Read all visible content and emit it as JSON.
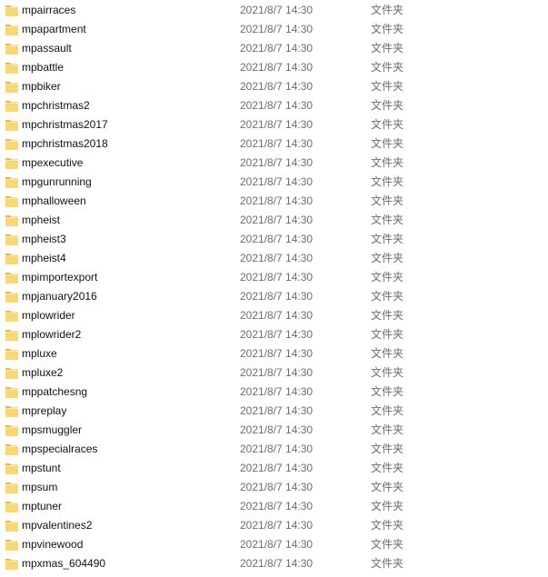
{
  "icons": {
    "folder": "folder-icon",
    "folder_color": "#F8D775",
    "folder_tab_color": "#E8B84A"
  },
  "files": [
    {
      "name": "mpairraces",
      "modified": "2021/8/7 14:30",
      "type": "文件夹"
    },
    {
      "name": "mpapartment",
      "modified": "2021/8/7 14:30",
      "type": "文件夹"
    },
    {
      "name": "mpassault",
      "modified": "2021/8/7 14:30",
      "type": "文件夹"
    },
    {
      "name": "mpbattle",
      "modified": "2021/8/7 14:30",
      "type": "文件夹"
    },
    {
      "name": "mpbiker",
      "modified": "2021/8/7 14:30",
      "type": "文件夹"
    },
    {
      "name": "mpchristmas2",
      "modified": "2021/8/7 14:30",
      "type": "文件夹"
    },
    {
      "name": "mpchristmas2017",
      "modified": "2021/8/7 14:30",
      "type": "文件夹"
    },
    {
      "name": "mpchristmas2018",
      "modified": "2021/8/7 14:30",
      "type": "文件夹"
    },
    {
      "name": "mpexecutive",
      "modified": "2021/8/7 14:30",
      "type": "文件夹"
    },
    {
      "name": "mpgunrunning",
      "modified": "2021/8/7 14:30",
      "type": "文件夹"
    },
    {
      "name": "mphalloween",
      "modified": "2021/8/7 14:30",
      "type": "文件夹"
    },
    {
      "name": "mpheist",
      "modified": "2021/8/7 14:30",
      "type": "文件夹"
    },
    {
      "name": "mpheist3",
      "modified": "2021/8/7 14:30",
      "type": "文件夹"
    },
    {
      "name": "mpheist4",
      "modified": "2021/8/7 14:30",
      "type": "文件夹"
    },
    {
      "name": "mpimportexport",
      "modified": "2021/8/7 14:30",
      "type": "文件夹"
    },
    {
      "name": "mpjanuary2016",
      "modified": "2021/8/7 14:30",
      "type": "文件夹"
    },
    {
      "name": "mplowrider",
      "modified": "2021/8/7 14:30",
      "type": "文件夹"
    },
    {
      "name": "mplowrider2",
      "modified": "2021/8/7 14:30",
      "type": "文件夹"
    },
    {
      "name": "mpluxe",
      "modified": "2021/8/7 14:30",
      "type": "文件夹"
    },
    {
      "name": "mpluxe2",
      "modified": "2021/8/7 14:30",
      "type": "文件夹"
    },
    {
      "name": "mppatchesng",
      "modified": "2021/8/7 14:30",
      "type": "文件夹"
    },
    {
      "name": "mpreplay",
      "modified": "2021/8/7 14:30",
      "type": "文件夹"
    },
    {
      "name": "mpsmuggler",
      "modified": "2021/8/7 14:30",
      "type": "文件夹"
    },
    {
      "name": "mpspecialraces",
      "modified": "2021/8/7 14:30",
      "type": "文件夹"
    },
    {
      "name": "mpstunt",
      "modified": "2021/8/7 14:30",
      "type": "文件夹"
    },
    {
      "name": "mpsum",
      "modified": "2021/8/7 14:30",
      "type": "文件夹"
    },
    {
      "name": "mptuner",
      "modified": "2021/8/7 14:30",
      "type": "文件夹"
    },
    {
      "name": "mpvalentines2",
      "modified": "2021/8/7 14:30",
      "type": "文件夹"
    },
    {
      "name": "mpvinewood",
      "modified": "2021/8/7 14:30",
      "type": "文件夹"
    },
    {
      "name": "mpxmas_604490",
      "modified": "2021/8/7 14:30",
      "type": "文件夹"
    }
  ]
}
